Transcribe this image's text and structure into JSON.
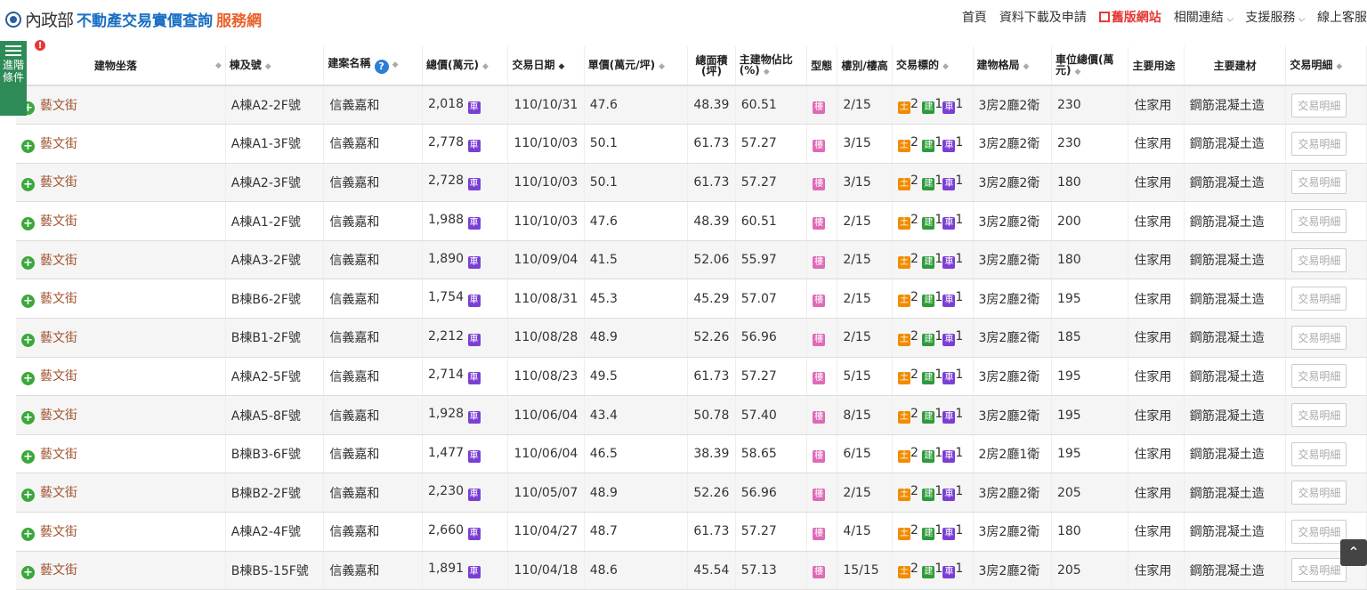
{
  "header": {
    "logo_ministry": "內政部",
    "logo_site": "不動產交易實價查詢",
    "logo_suffix": "服務網",
    "nav": {
      "home": "首頁",
      "download": "資料下載及申請",
      "old_site": "舊版網站",
      "links": "相關連結",
      "support": "支援服務",
      "service": "線上客服"
    }
  },
  "advanced": {
    "label": "進階條件",
    "badge": "!"
  },
  "columns": {
    "location": "建物坐落",
    "building": "棟及號",
    "project": "建案名稱",
    "total": "總價(萬元)",
    "date": "交易日期",
    "unit": "單價(萬元/坪)",
    "area": "總面積(坪)",
    "main_ratio": "主建物佔比(%)",
    "type": "型態",
    "floor": "樓別/樓高",
    "target": "交易標的",
    "layout": "建物格局",
    "parking": "車位總價(萬元)",
    "use": "主要用途",
    "material": "主要建材",
    "detail": "交易明細"
  },
  "labels": {
    "car": "車",
    "lou": "樓",
    "tu": "土",
    "jian": "建",
    "che": "車",
    "help": "?",
    "detail_btn": "交易明細",
    "plus": "+"
  },
  "rows": [
    {
      "loc": "藝文街",
      "bld": "A棟A2-2F號",
      "proj": "信義嘉和",
      "total": "2,018",
      "date": "110/10/31",
      "unit": "47.6",
      "area": "48.39",
      "ratio": "60.51",
      "floor": "2/15",
      "tu": "2",
      "jian": "1",
      "che": "1",
      "layout": "3房2廳2衛",
      "park": "230",
      "use": "住家用",
      "mat": "鋼筋混凝土造"
    },
    {
      "loc": "藝文街",
      "bld": "A棟A1-3F號",
      "proj": "信義嘉和",
      "total": "2,778",
      "date": "110/10/03",
      "unit": "50.1",
      "area": "61.73",
      "ratio": "57.27",
      "floor": "3/15",
      "tu": "2",
      "jian": "1",
      "che": "1",
      "layout": "3房2廳2衛",
      "park": "230",
      "use": "住家用",
      "mat": "鋼筋混凝土造"
    },
    {
      "loc": "藝文街",
      "bld": "A棟A2-3F號",
      "proj": "信義嘉和",
      "total": "2,728",
      "date": "110/10/03",
      "unit": "50.1",
      "area": "61.73",
      "ratio": "57.27",
      "floor": "3/15",
      "tu": "2",
      "jian": "1",
      "che": "1",
      "layout": "3房2廳2衛",
      "park": "180",
      "use": "住家用",
      "mat": "鋼筋混凝土造"
    },
    {
      "loc": "藝文街",
      "bld": "A棟A1-2F號",
      "proj": "信義嘉和",
      "total": "1,988",
      "date": "110/10/03",
      "unit": "47.6",
      "area": "48.39",
      "ratio": "60.51",
      "floor": "2/15",
      "tu": "2",
      "jian": "1",
      "che": "1",
      "layout": "3房2廳2衛",
      "park": "200",
      "use": "住家用",
      "mat": "鋼筋混凝土造"
    },
    {
      "loc": "藝文街",
      "bld": "A棟A3-2F號",
      "proj": "信義嘉和",
      "total": "1,890",
      "date": "110/09/04",
      "unit": "41.5",
      "area": "52.06",
      "ratio": "55.97",
      "floor": "2/15",
      "tu": "2",
      "jian": "1",
      "che": "1",
      "layout": "3房2廳2衛",
      "park": "180",
      "use": "住家用",
      "mat": "鋼筋混凝土造"
    },
    {
      "loc": "藝文街",
      "bld": "B棟B6-2F號",
      "proj": "信義嘉和",
      "total": "1,754",
      "date": "110/08/31",
      "unit": "45.3",
      "area": "45.29",
      "ratio": "57.07",
      "floor": "2/15",
      "tu": "2",
      "jian": "1",
      "che": "1",
      "layout": "3房2廳2衛",
      "park": "195",
      "use": "住家用",
      "mat": "鋼筋混凝土造"
    },
    {
      "loc": "藝文街",
      "bld": "B棟B1-2F號",
      "proj": "信義嘉和",
      "total": "2,212",
      "date": "110/08/28",
      "unit": "48.9",
      "area": "52.26",
      "ratio": "56.96",
      "floor": "2/15",
      "tu": "2",
      "jian": "1",
      "che": "1",
      "layout": "3房2廳2衛",
      "park": "185",
      "use": "住家用",
      "mat": "鋼筋混凝土造"
    },
    {
      "loc": "藝文街",
      "bld": "A棟A2-5F號",
      "proj": "信義嘉和",
      "total": "2,714",
      "date": "110/08/23",
      "unit": "49.5",
      "area": "61.73",
      "ratio": "57.27",
      "floor": "5/15",
      "tu": "2",
      "jian": "1",
      "che": "1",
      "layout": "3房2廳2衛",
      "park": "195",
      "use": "住家用",
      "mat": "鋼筋混凝土造"
    },
    {
      "loc": "藝文街",
      "bld": "A棟A5-8F號",
      "proj": "信義嘉和",
      "total": "1,928",
      "date": "110/06/04",
      "unit": "43.4",
      "area": "50.78",
      "ratio": "57.40",
      "floor": "8/15",
      "tu": "2",
      "jian": "1",
      "che": "1",
      "layout": "3房2廳2衛",
      "park": "195",
      "use": "住家用",
      "mat": "鋼筋混凝土造"
    },
    {
      "loc": "藝文街",
      "bld": "B棟B3-6F號",
      "proj": "信義嘉和",
      "total": "1,477",
      "date": "110/06/04",
      "unit": "46.5",
      "area": "38.39",
      "ratio": "58.65",
      "floor": "6/15",
      "tu": "2",
      "jian": "1",
      "che": "1",
      "layout": "2房2廳1衛",
      "park": "195",
      "use": "住家用",
      "mat": "鋼筋混凝土造"
    },
    {
      "loc": "藝文街",
      "bld": "B棟B2-2F號",
      "proj": "信義嘉和",
      "total": "2,230",
      "date": "110/05/07",
      "unit": "48.9",
      "area": "52.26",
      "ratio": "56.96",
      "floor": "2/15",
      "tu": "2",
      "jian": "1",
      "che": "1",
      "layout": "3房2廳2衛",
      "park": "205",
      "use": "住家用",
      "mat": "鋼筋混凝土造"
    },
    {
      "loc": "藝文街",
      "bld": "A棟A2-4F號",
      "proj": "信義嘉和",
      "total": "2,660",
      "date": "110/04/27",
      "unit": "48.7",
      "area": "61.73",
      "ratio": "57.27",
      "floor": "4/15",
      "tu": "2",
      "jian": "1",
      "che": "1",
      "layout": "3房2廳2衛",
      "park": "180",
      "use": "住家用",
      "mat": "鋼筋混凝土造"
    },
    {
      "loc": "藝文街",
      "bld": "B棟B5-15F號",
      "proj": "信義嘉和",
      "total": "1,891",
      "date": "110/04/18",
      "unit": "48.6",
      "area": "45.54",
      "ratio": "57.13",
      "floor": "15/15",
      "tu": "2",
      "jian": "1",
      "che": "1",
      "layout": "3房2廳2衛",
      "park": "205",
      "use": "住家用",
      "mat": "鋼筋混凝土造"
    }
  ]
}
